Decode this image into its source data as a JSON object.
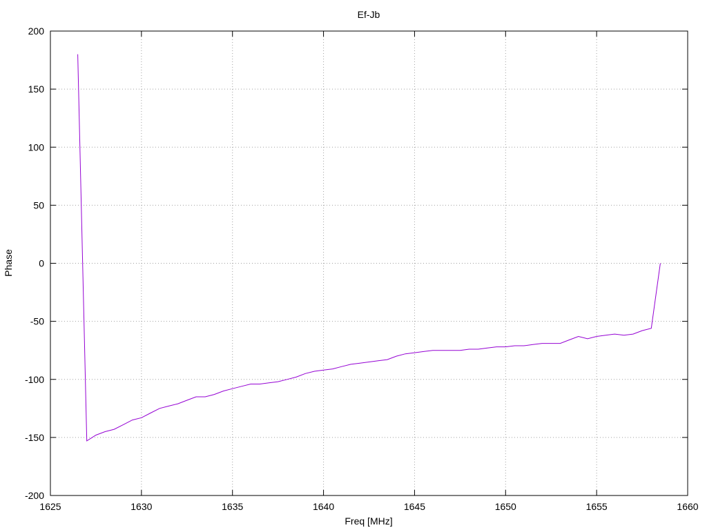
{
  "chart_data": {
    "type": "line",
    "title": "Ef-Jb",
    "xlabel": "Freq [MHz]",
    "ylabel": "Phase",
    "xlim": [
      1625,
      1660
    ],
    "ylim": [
      -200,
      200
    ],
    "xticks": [
      1625,
      1630,
      1635,
      1640,
      1645,
      1650,
      1655,
      1660
    ],
    "yticks": [
      -200,
      -150,
      -100,
      -50,
      0,
      50,
      100,
      150,
      200
    ],
    "grid": true,
    "line_color": "#9400d3",
    "series": [
      {
        "x": [
          1626.5,
          1627.0,
          1627.5,
          1628.0,
          1628.5,
          1629.0,
          1629.5,
          1630.0,
          1630.5,
          1631.0,
          1631.5,
          1632.0,
          1632.5,
          1633.0,
          1633.5,
          1634.0,
          1634.5,
          1635.0,
          1635.5,
          1636.0,
          1636.5,
          1637.0,
          1637.5,
          1638.0,
          1638.5,
          1639.0,
          1639.5,
          1640.0,
          1640.5,
          1641.0,
          1641.5,
          1642.0,
          1642.5,
          1643.0,
          1643.5,
          1644.0,
          1644.5,
          1645.0,
          1645.5,
          1646.0,
          1646.5,
          1647.0,
          1647.5,
          1648.0,
          1648.5,
          1649.0,
          1649.5,
          1650.0,
          1650.5,
          1651.0,
          1651.5,
          1652.0,
          1652.5,
          1653.0,
          1653.5,
          1654.0,
          1654.5,
          1655.0,
          1655.5,
          1656.0,
          1656.5,
          1657.0,
          1657.5,
          1658.0,
          1658.5
        ],
        "y": [
          180,
          -153,
          -148,
          -145,
          -143,
          -139,
          -135,
          -133,
          -129,
          -125,
          -123,
          -121,
          -118,
          -115,
          -115,
          -113,
          -110,
          -108,
          -106,
          -104,
          -104,
          -103,
          -102,
          -100,
          -98,
          -95,
          -93,
          -92,
          -91,
          -89,
          -87,
          -86,
          -85,
          -84,
          -83,
          -80,
          -78,
          -77,
          -76,
          -75,
          -75,
          -75,
          -75,
          -74,
          -74,
          -73,
          -72,
          -72,
          -71,
          -71,
          -70,
          -69,
          -69,
          -69,
          -66,
          -63,
          -65,
          -63,
          -62,
          -61,
          -62,
          -61,
          -58,
          -56,
          0
        ]
      }
    ]
  }
}
